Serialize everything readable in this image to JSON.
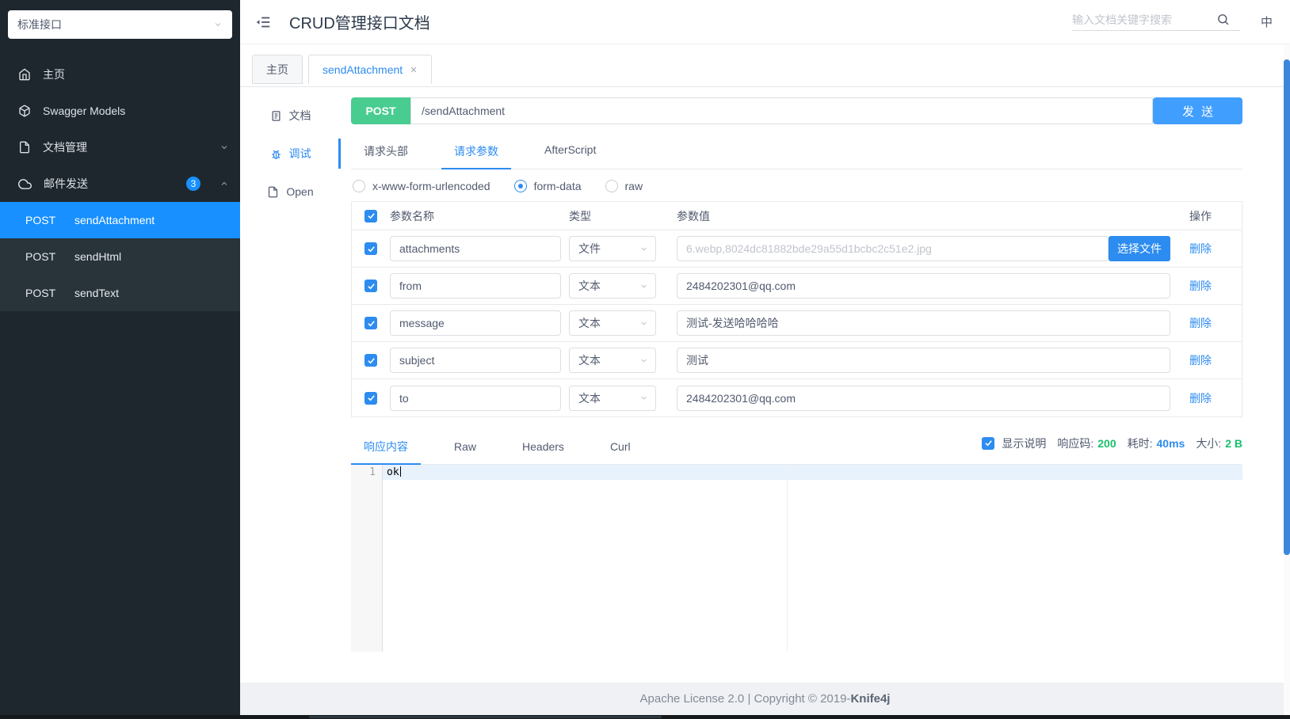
{
  "colors": {
    "accent": "#2d8cf0",
    "sidebar_bg": "#1e272e",
    "sidebar_active": "#1890ff",
    "method_post": "#49cc90",
    "send_button": "#409eff",
    "status_green": "#19be6b",
    "scrollbar_thumb": "#3d87db"
  },
  "sidebar": {
    "group_select": "标准接口",
    "items": [
      {
        "label": "主页",
        "icon": "home"
      },
      {
        "label": "Swagger Models",
        "icon": "box"
      },
      {
        "label": "文档管理",
        "icon": "file-gear",
        "chevron": "down"
      },
      {
        "label": "邮件发送",
        "icon": "cloud",
        "badge": "3",
        "chevron": "up"
      }
    ],
    "sub_items": [
      {
        "method": "POST",
        "label": "sendAttachment",
        "active": true
      },
      {
        "method": "POST",
        "label": "sendHtml",
        "active": false
      },
      {
        "method": "POST",
        "label": "sendText",
        "active": false
      }
    ]
  },
  "header": {
    "title": "CRUD管理接口文档",
    "search_placeholder": "输入文档关键字搜索",
    "lang": "中"
  },
  "tabs": [
    {
      "label": "主页",
      "active": false
    },
    {
      "label": "sendAttachment",
      "active": true,
      "closable": true
    }
  ],
  "doc_nav": [
    {
      "label": "文档",
      "active": false
    },
    {
      "label": "调试",
      "active": true
    },
    {
      "label": "Open",
      "active": false
    }
  ],
  "request": {
    "method": "POST",
    "path": "/sendAttachment",
    "send_label": "发送",
    "tabs": [
      "请求头部",
      "请求参数",
      "AfterScript"
    ],
    "active_tab": "请求参数",
    "body_types": [
      "x-www-form-urlencoded",
      "form-data",
      "raw"
    ],
    "selected_body_type": "form-data",
    "table": {
      "headers": [
        "参数名称",
        "类型",
        "参数值",
        "操作"
      ],
      "file_button": "选择文件",
      "rows": [
        {
          "name": "attachments",
          "type": "文件",
          "value": "6.webp,8024dc81882bde29a55d1bcbc2c51e2.jpg",
          "action": "删除"
        },
        {
          "name": "from",
          "type": "文本",
          "value": "2484202301@qq.com",
          "action": "删除"
        },
        {
          "name": "message",
          "type": "文本",
          "value": "测试-发送哈哈哈哈",
          "action": "删除"
        },
        {
          "name": "subject",
          "type": "文本",
          "value": "测试",
          "action": "删除"
        },
        {
          "name": "to",
          "type": "文本",
          "value": "2484202301@qq.com",
          "action": "删除"
        }
      ]
    }
  },
  "response": {
    "tabs": [
      "响应内容",
      "Raw",
      "Headers",
      "Curl"
    ],
    "active_tab": "响应内容",
    "show_desc_label": "显示说明",
    "status": {
      "code_label": "响应码:",
      "code": "200",
      "time_label": "耗时:",
      "time": "40ms",
      "size_label": "大小:",
      "size": "2 B"
    },
    "editor": {
      "line_number": "1",
      "content": "ok"
    }
  },
  "footer": {
    "text": "Apache License 2.0 | Copyright © 2019-",
    "brand": "Knife4j"
  }
}
